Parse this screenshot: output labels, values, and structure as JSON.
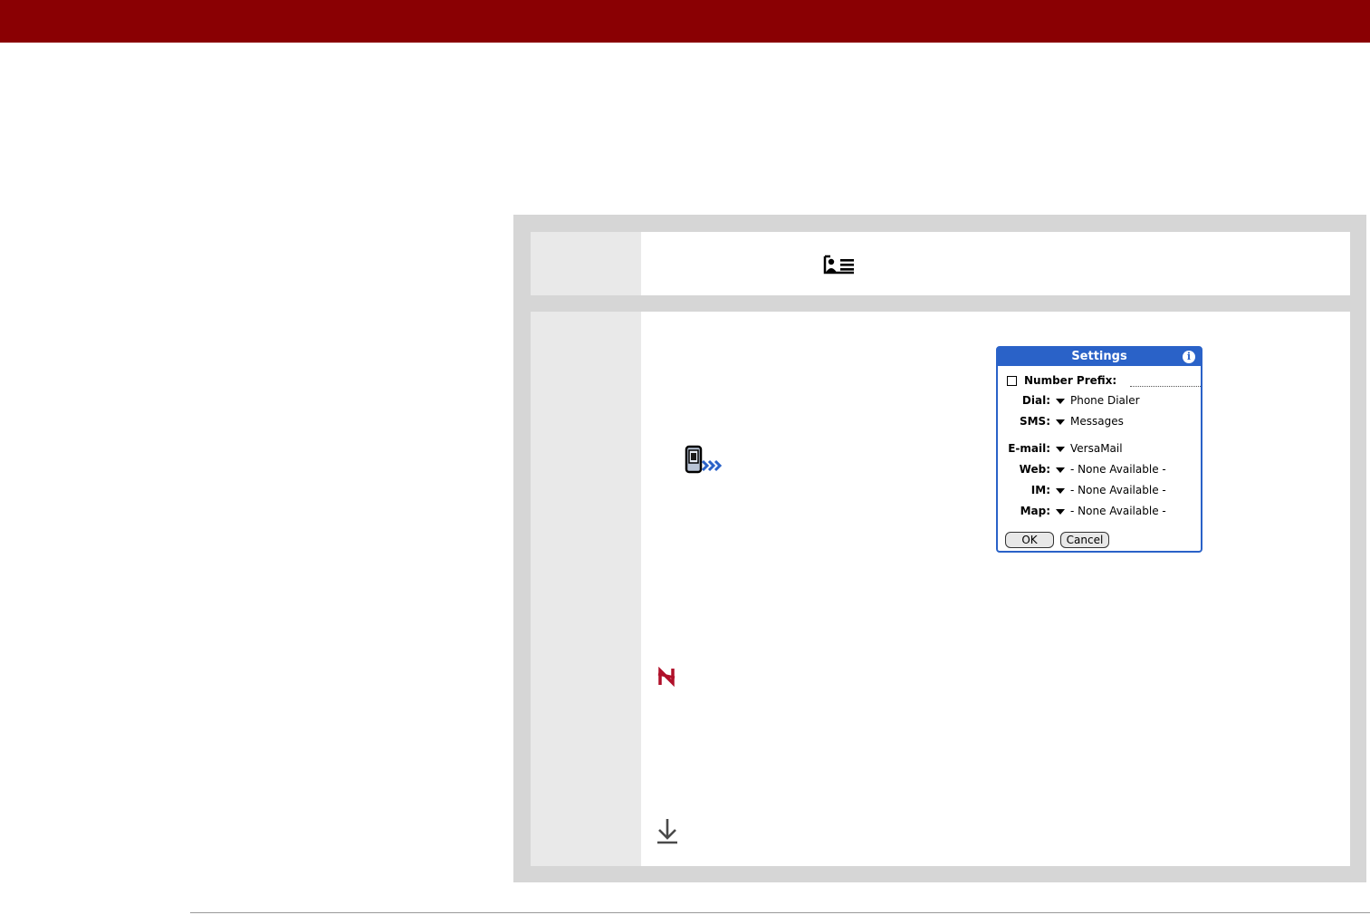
{
  "dialog": {
    "title": "Settings",
    "info_glyph": "i",
    "number_prefix_label": "Number Prefix:",
    "fields": [
      {
        "label": "Dial:",
        "value": "Phone Dialer"
      },
      {
        "label": "SMS:",
        "value": "Messages"
      },
      {
        "label": "E-mail:",
        "value": "VersaMail"
      },
      {
        "label": "Web:",
        "value": "- None Available -"
      },
      {
        "label": "IM:",
        "value": "- None Available -"
      },
      {
        "label": "Map:",
        "value": "- None Available -"
      }
    ],
    "ok_label": "OK",
    "cancel_label": "Cancel"
  },
  "icons": {
    "contacts": "contacts-app-icon",
    "handheld": "handheld-arrows-icon",
    "tip": "tip-icon",
    "download": "download-arrow-icon"
  },
  "colors": {
    "header_bar": "#8a0003",
    "dialog_accent": "#2a62c8",
    "tip_icon": "#b0102a"
  }
}
